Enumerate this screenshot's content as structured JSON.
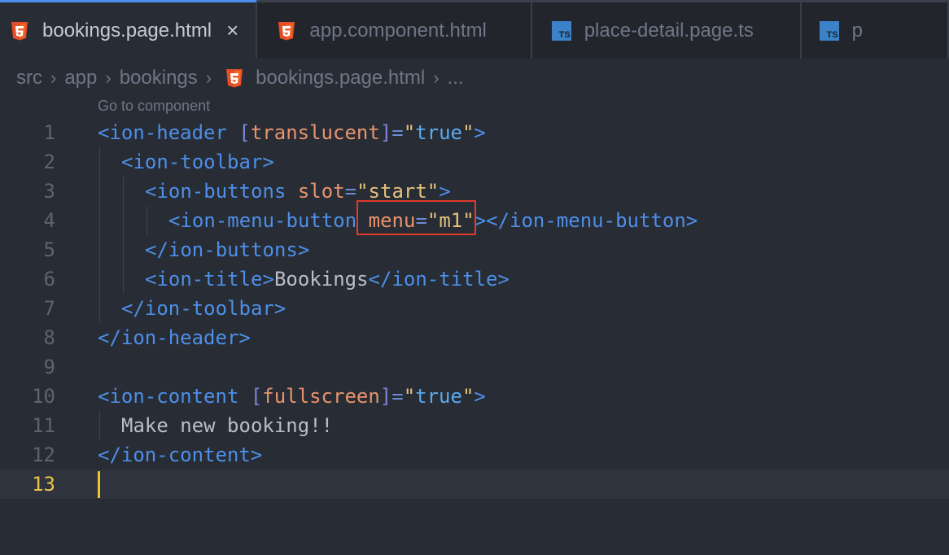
{
  "tabs": [
    {
      "label": "bookings.page.html",
      "icon": "html5-icon",
      "active": true,
      "close": "×"
    },
    {
      "label": "app.component.html",
      "icon": "html5-icon"
    },
    {
      "label": "place-detail.page.ts",
      "icon": "typescript-icon",
      "badge": "TS"
    },
    {
      "label": "p",
      "icon": "typescript-icon",
      "badge": "TS"
    }
  ],
  "breadcrumb": [
    "src",
    "app",
    "bookings",
    "bookings.page.html",
    "..."
  ],
  "hint": "Go to component",
  "colors": {
    "tag": "#4d8fe8",
    "attribute": "#e8946e",
    "string": "#e5c07b",
    "annotation": "#e03a2a",
    "cursor": "#f0c530"
  },
  "lines": [
    {
      "n": "1",
      "indent": 0,
      "tokens": [
        [
          "tag",
          "<ion-header"
        ],
        [
          "plain",
          " "
        ],
        [
          "br",
          "["
        ],
        [
          "attr",
          "translucent"
        ],
        [
          "br",
          "]"
        ],
        [
          "eq",
          "="
        ],
        [
          "str",
          "\""
        ],
        [
          "val",
          "true"
        ],
        [
          "str",
          "\""
        ],
        [
          "tag",
          ">"
        ]
      ]
    },
    {
      "n": "2",
      "indent": 1,
      "tokens": [
        [
          "tag",
          "<ion-toolbar>"
        ]
      ]
    },
    {
      "n": "3",
      "indent": 2,
      "tokens": [
        [
          "tag",
          "<ion-buttons"
        ],
        [
          "plain",
          " "
        ],
        [
          "attr",
          "slot"
        ],
        [
          "eq",
          "="
        ],
        [
          "str",
          "\"start\""
        ],
        [
          "tag",
          ">"
        ]
      ]
    },
    {
      "n": "4",
      "indent": 3,
      "tokens": [
        [
          "tag",
          "<ion-menu-button"
        ],
        [
          "plain",
          " "
        ],
        [
          "attr",
          "menu"
        ],
        [
          "eq",
          "="
        ],
        [
          "str",
          "\"m1\""
        ],
        [
          "tag",
          "></ion-menu-button>"
        ]
      ]
    },
    {
      "n": "5",
      "indent": 2,
      "tokens": [
        [
          "tag",
          "</ion-buttons>"
        ]
      ]
    },
    {
      "n": "6",
      "indent": 2,
      "tokens": [
        [
          "tag",
          "<ion-title>"
        ],
        [
          "plain",
          "Bookings"
        ],
        [
          "tag",
          "</ion-title>"
        ]
      ]
    },
    {
      "n": "7",
      "indent": 1,
      "tokens": [
        [
          "tag",
          "</ion-toolbar>"
        ]
      ]
    },
    {
      "n": "8",
      "indent": 0,
      "tokens": [
        [
          "tag",
          "</ion-header>"
        ]
      ]
    },
    {
      "n": "9",
      "indent": 0,
      "tokens": []
    },
    {
      "n": "10",
      "indent": 0,
      "tokens": [
        [
          "tag",
          "<ion-content"
        ],
        [
          "plain",
          " "
        ],
        [
          "br",
          "["
        ],
        [
          "attr",
          "fullscreen"
        ],
        [
          "br",
          "]"
        ],
        [
          "eq",
          "="
        ],
        [
          "str",
          "\""
        ],
        [
          "val",
          "true"
        ],
        [
          "str",
          "\""
        ],
        [
          "tag",
          ">"
        ]
      ]
    },
    {
      "n": "11",
      "indent": 1,
      "tokens": [
        [
          "plain",
          "Make new booking!!"
        ]
      ]
    },
    {
      "n": "12",
      "indent": 0,
      "tokens": [
        [
          "tag",
          "</ion-content>"
        ]
      ]
    },
    {
      "n": "13",
      "indent": 0,
      "tokens": [],
      "current": true
    }
  ]
}
